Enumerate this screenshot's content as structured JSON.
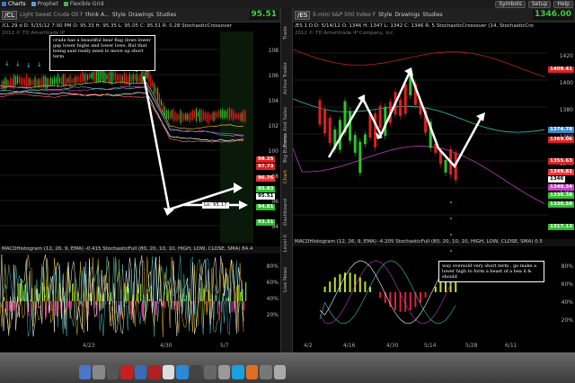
{
  "tabs": [
    {
      "label": "Charts",
      "color": "#3a7bd5",
      "active": true
    },
    {
      "label": "Prophet",
      "color": "#5aa0e0",
      "active": false
    },
    {
      "label": "Flexible Grid",
      "color": "#4caf50",
      "active": false
    }
  ],
  "top_right": [
    "Symbols",
    "Setup",
    "Help"
  ],
  "left": {
    "symbol": "/CL",
    "description": "Light Sweet Crude Oil Futu",
    "think": "think A...",
    "style": "Style",
    "drawings": "Drawings",
    "studies": "Studies",
    "price": "95.51",
    "price_color": "#3cd23c",
    "info": "/CL 29 d  D: 5/15/12 7:00 PM  O: 95.33  H: 95.35  L: 95.05  C: 95.51  R: 0.28  StochasticCrossover",
    "subinfo": "2012 © TD Ameritrade IP",
    "axis_ticks": [
      "108",
      "106",
      "104",
      "102",
      "100",
      "98",
      "96",
      "94"
    ],
    "price_tags": [
      {
        "text": "98.25",
        "bg": "#e02020"
      },
      {
        "text": "97.73",
        "bg": "#e02020"
      },
      {
        "text": "96.76",
        "bg": "#ff3030"
      },
      {
        "text": "95.83",
        "bg": "#30c030"
      },
      {
        "text": "95.51",
        "bg": "#ffffff"
      },
      {
        "text": "94.81",
        "bg": "#30c030"
      },
      {
        "text": "93.31",
        "bg": "#30c030"
      }
    ],
    "lo_label": "Lo: 95.17",
    "macd_bar": "MACDHistogram (12, 26, 9, EMA)  -0.415  StochasticFull (80, 20, 10, 10, HIGH, LOW, CLOSE, SMA)  84.4",
    "osc_ticks": [
      "80%",
      "60%",
      "40%",
      "20%"
    ],
    "x_ticks": [
      "4/23",
      "4/30",
      "5/7"
    ],
    "note": "crude has a beautiful bear flag (lows lower gap lower highs and lower lows. But that being said really need to move up short term"
  },
  "right": {
    "symbol": "/ES",
    "description": "E-mini S&P 500 Index Futures (ITM)",
    "think": "",
    "style": "Style",
    "drawings": "Drawings",
    "studies": "Studies",
    "price": "1346.00",
    "price_color": "#3cd23c",
    "info": "/ES 1 D  D: 5/14/12  O: 1346  H: 1347  L: 1342  C: 1346  R: 5  StochasticCrossover (14, StochasticCro",
    "subinfo": "2012 © TD Ameritrade IP Company, Inc.",
    "axis_ticks": [
      "1420",
      "1400",
      "1380",
      "1360",
      "1340",
      "1320"
    ],
    "price_tags": [
      {
        "text": "1409.41",
        "bg": "#e02020"
      },
      {
        "text": "1374.78",
        "bg": "#3a8ad5"
      },
      {
        "text": "1369.06",
        "bg": "#e02020"
      },
      {
        "text": "1355.63",
        "bg": "#e02020"
      },
      {
        "text": "1349.81",
        "bg": "#ff3030"
      },
      {
        "text": "1346",
        "bg": "#ffffff"
      },
      {
        "text": "1340.34",
        "bg": "#cc40cc"
      },
      {
        "text": "1336.38",
        "bg": "#30c030"
      },
      {
        "text": "1330.58",
        "bg": "#30c030"
      },
      {
        "text": "1317.13",
        "bg": "#30c030"
      }
    ],
    "macd_bar": "MACDHistogram (12, 26, 9, EMA)  -4.205  StochasticFull (80, 20, 10, 10, HIGH, LOW, CLOSE, SMA)  0.5",
    "osc_ticks": [
      "80%",
      "60%",
      "40%",
      "20%"
    ],
    "x_ticks": [
      "4/2",
      "4/16",
      "4/30",
      "5/14",
      "5/28",
      "6/11"
    ],
    "note": "way oversold very short term , go make a lower high to form a beast of a bea il & should"
  },
  "side_tabs": [
    "Trade",
    "Active Trader",
    "Times And Sales",
    "Big Buttons",
    "Chart",
    "Dashboard",
    "Level II",
    "Live News"
  ]
}
